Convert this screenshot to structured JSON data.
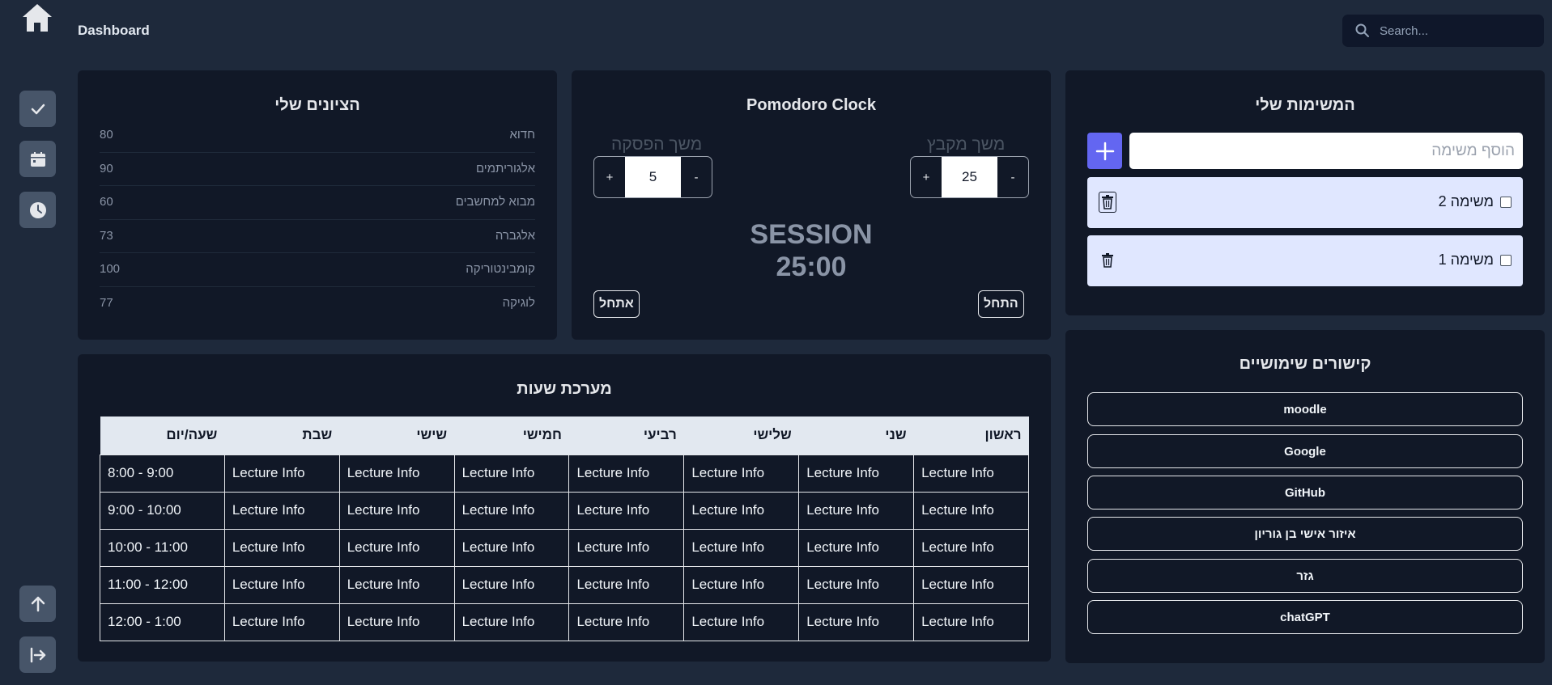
{
  "header": {
    "title": "Dashboard",
    "search_placeholder": "Search..."
  },
  "sidebar": {
    "icons": [
      "home-icon",
      "check-icon",
      "calendar-icon",
      "clock-icon",
      "arrow-up-icon",
      "logout-icon"
    ]
  },
  "grades": {
    "title": "הציונים שלי",
    "items": [
      {
        "name": "חדוא",
        "grade": "80"
      },
      {
        "name": "אלגוריתמים",
        "grade": "90"
      },
      {
        "name": "מבוא למחשבים",
        "grade": "60"
      },
      {
        "name": "אלגברה",
        "grade": "73"
      },
      {
        "name": "קומבינטוריקה",
        "grade": "100"
      },
      {
        "name": "לוגיקה",
        "grade": "77"
      }
    ]
  },
  "pomodoro": {
    "title": "Pomodoro Clock",
    "break_label": "משך הפסקה",
    "session_label": "משך מקבץ",
    "break_value": "5",
    "session_value": "25",
    "plus": "+",
    "minus": "-",
    "state": "SESSION",
    "time": "25:00",
    "reset_label": "אתחל",
    "start_label": "התחל"
  },
  "tasks": {
    "title": "המשימות שלי",
    "input_placeholder": "הוסף משימה",
    "items": [
      {
        "label": "משימה 2"
      },
      {
        "label": "משימה 1"
      }
    ]
  },
  "schedule": {
    "title": "מערכת שעות",
    "headers": [
      "שעה/יום",
      "שבת",
      "שישי",
      "חמישי",
      "רביעי",
      "שלישי",
      "שני",
      "ראשון"
    ],
    "rows": [
      [
        "8:00 - 9:00",
        "Lecture Info",
        "Lecture Info",
        "Lecture Info",
        "Lecture Info",
        "Lecture Info",
        "Lecture Info",
        "Lecture Info"
      ],
      [
        "9:00 - 10:00",
        "Lecture Info",
        "Lecture Info",
        "Lecture Info",
        "Lecture Info",
        "Lecture Info",
        "Lecture Info",
        "Lecture Info"
      ],
      [
        "10:00 - 11:00",
        "Lecture Info",
        "Lecture Info",
        "Lecture Info",
        "Lecture Info",
        "Lecture Info",
        "Lecture Info",
        "Lecture Info"
      ],
      [
        "11:00 - 12:00",
        "Lecture Info",
        "Lecture Info",
        "Lecture Info",
        "Lecture Info",
        "Lecture Info",
        "Lecture Info",
        "Lecture Info"
      ],
      [
        "12:00 - 1:00",
        "Lecture Info",
        "Lecture Info",
        "Lecture Info",
        "Lecture Info",
        "Lecture Info",
        "Lecture Info",
        "Lecture Info"
      ]
    ]
  },
  "links": {
    "title": "קישורים שימושיים",
    "items": [
      "moodle",
      "Google",
      "GitHub",
      "איזור אישי בן גוריון",
      "גזר",
      "chatGPT"
    ]
  },
  "colors": {
    "background": "#1e293b",
    "card": "#111827",
    "accent": "#6366f1",
    "task_bg": "#e0e7ff",
    "sidebar_btn": "#475569"
  }
}
